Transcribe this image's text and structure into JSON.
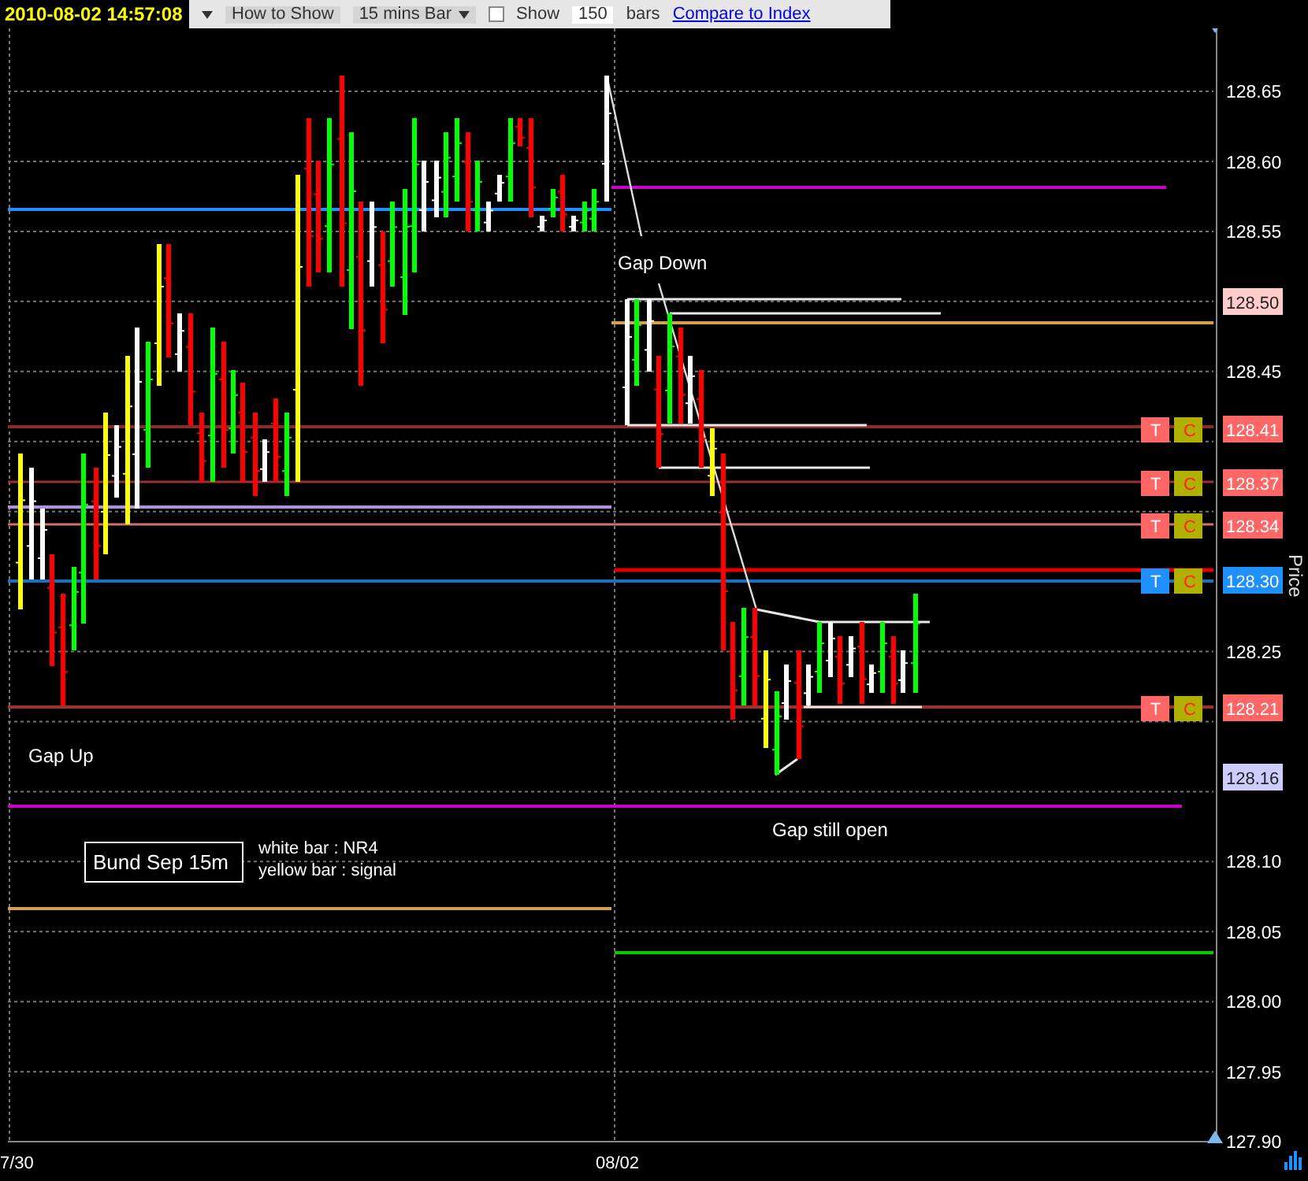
{
  "header": {
    "timestamp": "2010-08-02 14:57:08"
  },
  "toolbar": {
    "how_to_show_label": "How to Show",
    "interval": "15 mins Bar",
    "show_checkbox": {
      "label": "Show",
      "checked": false
    },
    "bars_count": "150",
    "bars_label": "bars",
    "compare_link": "Compare to Index"
  },
  "chart": {
    "title_box": "Bund Sep 15m",
    "legend": [
      "white bar : NR4",
      "yellow bar : signal"
    ],
    "annotations": [
      "Gap Up",
      "Gap Down",
      "Gap still open"
    ],
    "price_axis": {
      "title": "Price",
      "ticks": [
        "128.65",
        "128.60",
        "128.55",
        "128.45",
        "128.25",
        "128.10",
        "128.05",
        "128.00",
        "127.95",
        "127.90"
      ]
    },
    "time_axis": [
      "7/30",
      "08/02"
    ],
    "price_tags": [
      {
        "price": "128.50",
        "color": "#ffcccc"
      },
      {
        "price": "128.41",
        "color": "#ff6666",
        "buttons": [
          "T",
          "C"
        ]
      },
      {
        "price": "128.37",
        "color": "#ff6666",
        "buttons": [
          "T",
          "C"
        ]
      },
      {
        "price": "128.34",
        "color": "#ff6666",
        "buttons": [
          "T",
          "C"
        ]
      },
      {
        "price": "128.30",
        "color": "#1e90ff",
        "buttons": [
          "T",
          "C"
        ]
      },
      {
        "price": "128.21",
        "color": "#ff6666",
        "buttons": [
          "T",
          "C"
        ]
      },
      {
        "price": "128.16",
        "color": "#ccccff"
      }
    ]
  }
}
